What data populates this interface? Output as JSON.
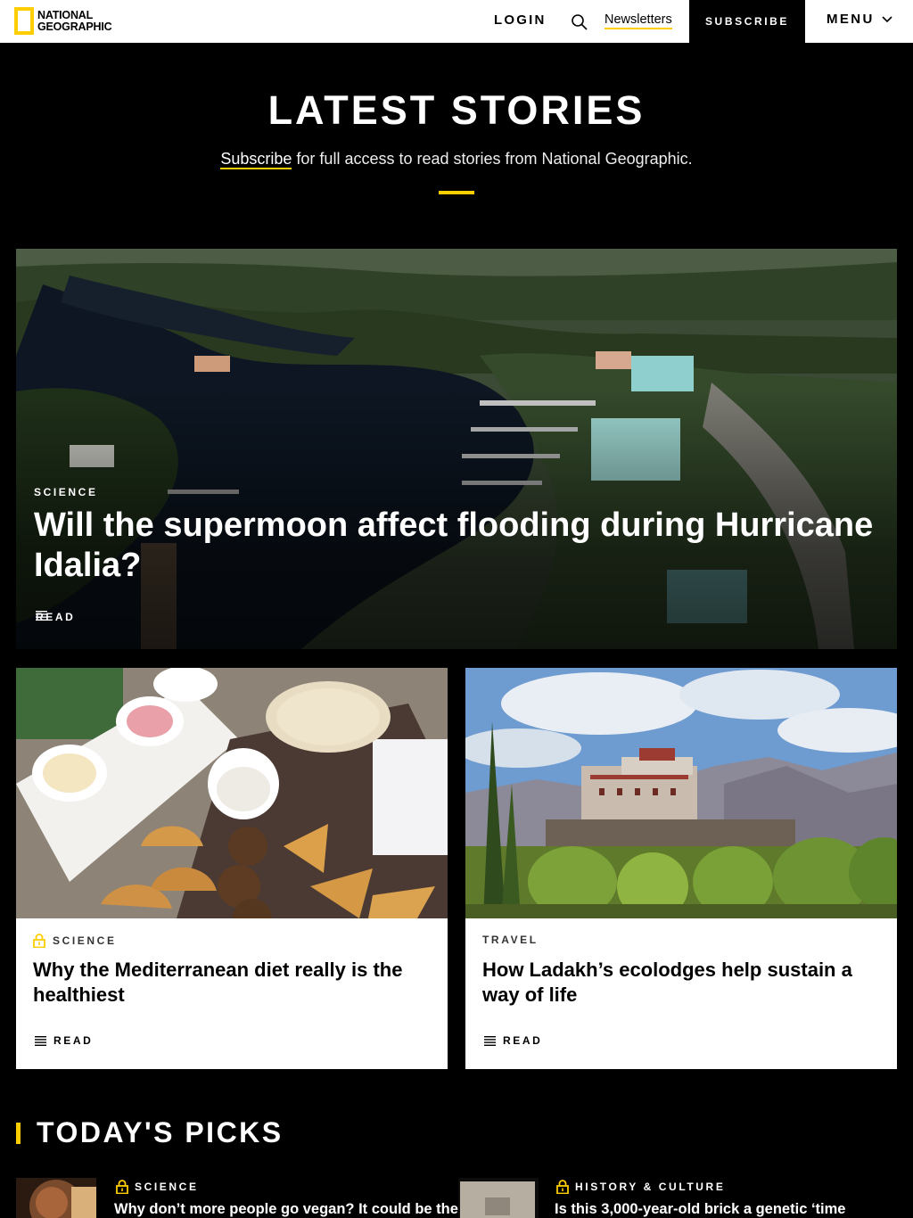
{
  "header": {
    "logo_line1": "NATIONAL",
    "logo_line2": "GEOGRAPHIC",
    "login": "LOGIN",
    "search_icon": "search-icon",
    "newsletters": "Newsletters",
    "subscribe": "SUBSCRIBE",
    "menu": "MENU"
  },
  "intro": {
    "title": "LATEST STORIES",
    "subscribe_link": "Subscribe",
    "subtitle_rest": " for full access to read stories from National Geographic."
  },
  "feature": {
    "category": "SCIENCE",
    "title": "Will the supermoon affect flooding during Hurricane Idalia?",
    "read": "READ"
  },
  "cards": [
    {
      "category": "SCIENCE",
      "locked": true,
      "title": "Why the Mediterranean diet really is the healthiest",
      "read": "READ"
    },
    {
      "category": "TRAVEL",
      "locked": false,
      "title": "How Ladakh’s ecolodges help sustain a way of life",
      "read": "READ"
    }
  ],
  "picks": {
    "title": "TODAY'S PICKS",
    "items": [
      {
        "category": "SCIENCE",
        "locked": true,
        "title": "Why don’t more people go vegan? It could be the"
      },
      {
        "category": "HISTORY & CULTURE",
        "locked": true,
        "title": "Is this 3,000-year-old brick a genetic ‘time"
      }
    ]
  },
  "colors": {
    "accent": "#ffce00",
    "background": "#000000",
    "card": "#ffffff"
  }
}
